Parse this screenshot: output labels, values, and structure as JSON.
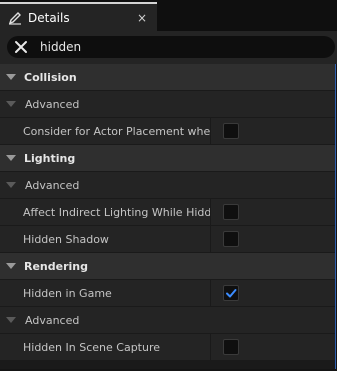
{
  "tab": {
    "title": "Details",
    "close": "×",
    "icon": "pencil-icon"
  },
  "search": {
    "value": "hidden",
    "clear_icon": "close-icon"
  },
  "rows": [
    {
      "kind": "category",
      "label": "Collision"
    },
    {
      "kind": "sub",
      "label": "Advanced"
    },
    {
      "kind": "prop",
      "label": "Consider for Actor Placement when...",
      "checked": false
    },
    {
      "kind": "category",
      "label": "Lighting"
    },
    {
      "kind": "sub",
      "label": "Advanced"
    },
    {
      "kind": "prop",
      "label": "Affect Indirect Lighting While Hidden",
      "checked": false
    },
    {
      "kind": "prop",
      "label": "Hidden Shadow",
      "checked": false
    },
    {
      "kind": "category",
      "label": "Rendering"
    },
    {
      "kind": "prop",
      "label": "Hidden in Game",
      "checked": true
    },
    {
      "kind": "sub",
      "label": "Advanced"
    },
    {
      "kind": "prop",
      "label": "Hidden In Scene Capture",
      "checked": false
    }
  ],
  "colors": {
    "accent": "#2d7be0",
    "checkmark": "#3b8cff"
  }
}
